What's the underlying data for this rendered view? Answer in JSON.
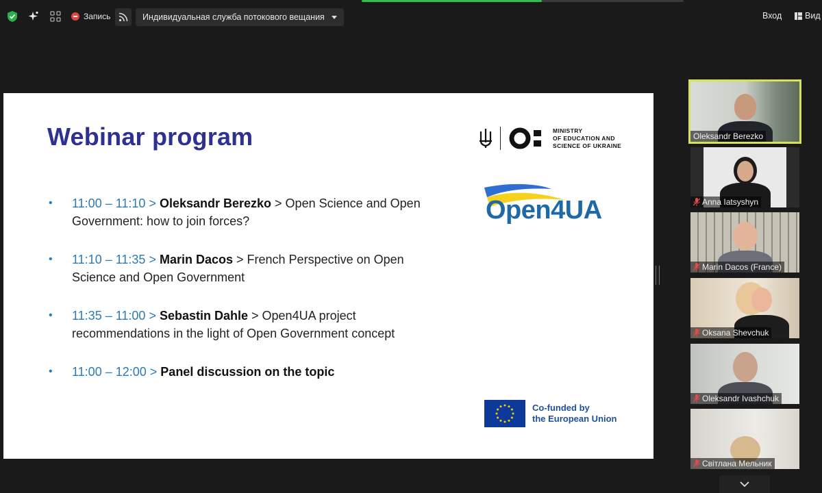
{
  "toolbar": {
    "recording_label": "Запись",
    "stream_label": "Индивидуальная служба потокового вещания",
    "enter_label": "Вход",
    "view_label": "Вид",
    "progress": 0.56,
    "icons": [
      "shield-check-icon",
      "sparkle-icon",
      "grid-icon",
      "record-icon",
      "rss-icon",
      "chevron-down-icon",
      "view-layout-icon"
    ]
  },
  "slide": {
    "title": "Webinar program",
    "ministry_lines": [
      "MINISTRY",
      "OF EDUCATION AND",
      "SCIENCE OF UKRAINE"
    ],
    "project_logo": "Open4UA",
    "items": [
      {
        "time": "11:00 – 11:10 >",
        "speaker": "Oleksandr Berezko",
        "topic": " > Open Science and Open Government: how to join forces?"
      },
      {
        "time": "11:10 – 11:35 >",
        "speaker": "Marin Dacos",
        "topic": " > French Perspective on Open Science and Open Government"
      },
      {
        "time": "11:35 – 11:00 >",
        "speaker": "Sebastin Dahle",
        "topic": " > Open4UA project recommendations in the light of Open Government concept"
      },
      {
        "time": "11:00 – 12:00 >",
        "speaker": "Panel discussion on the topic",
        "topic": ""
      }
    ],
    "eu_lines": [
      "Co-funded by",
      "the European Union"
    ]
  },
  "participants": [
    {
      "name": "Oleksandr Berezko",
      "muted": false,
      "active": true
    },
    {
      "name": "Anna Iatsyshyn",
      "muted": true,
      "active": false
    },
    {
      "name": "Marin Dacos (France)",
      "muted": true,
      "active": false
    },
    {
      "name": "Oksana Shevchuk",
      "muted": true,
      "active": false
    },
    {
      "name": "Oleksandr Ivashchuk",
      "muted": true,
      "active": false
    },
    {
      "name": "Світлана Мельник",
      "muted": true,
      "active": false
    }
  ],
  "colors": {
    "accent_green": "#2fbf4a",
    "active_outline": "#d8e15a",
    "title_blue": "#2e3192",
    "time_blue": "#2a7ab8"
  }
}
